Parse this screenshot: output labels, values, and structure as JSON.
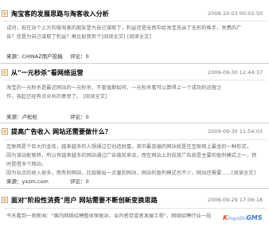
{
  "posts": [
    {
      "title": "淘宝客的发展思路与淘客收入分析",
      "date": "2009-10-03 00:02:50",
      "lines": [
        "试问，现在站个上万的做淘客的朋友是为自己谋取了，利益还是无而中给淘宝充当了无形的推手，免费的广",
        "告？还是为自己谋取了利益？再比如我有个[阅读全文] [阅读全文]"
      ],
      "source": "来源：CHINAZ用户投稿",
      "review": "评论：0"
    },
    {
      "title": "从\"一元秒杀\"看网络运营",
      "date": "2009-09-30 12:44:37",
      "lines": [
        "淘宝的一元秒杀是最近网站的一元秒杀，不管值期如何，一元秒杀看可以算得上一个成功的运营之",
        "作，容起已经有点众共的意思了。    [阅读全文]"
      ],
      "source": "来源：卢松松",
      "review": "评论：0"
    },
    {
      "title": "提高广告收入 网站还需要做什么？",
      "date": "2009-09-30 11:54:03",
      "lines": [
        "互联网是个巨大的金库，越来越多的人想通过它创造财富。其中最普遍的网站就是在互联网上最金的一种形式，",
        "因为该站能够转，所以有越来越多的网站通过广告做前来流，而在网站上的投放广告就是主要的盈利模式之一，转时是借多个网站，",
        "因为站点的收入很多，而有的网站，比如做出一点量的网站，网站的盈利模式也不少，网站还需要……[阅读全文]"
      ],
      "source": "来源：yxzm.com",
      "review": "评论：0"
    },
    {
      "title": "面对\"阶段性消费\"用户 网站需要不断创新变换思路",
      "date": "2009-09-29 17:06:18",
      "lines": [
        "今天看到一则新闻：\"国内网络招聘整体保留站，业内感觉或者发展工程\"，网络招聘行业一段"
      ]
    }
  ],
  "logo": {
    "a": "K",
    "b": "ingsDL",
    "c": "GMS"
  }
}
